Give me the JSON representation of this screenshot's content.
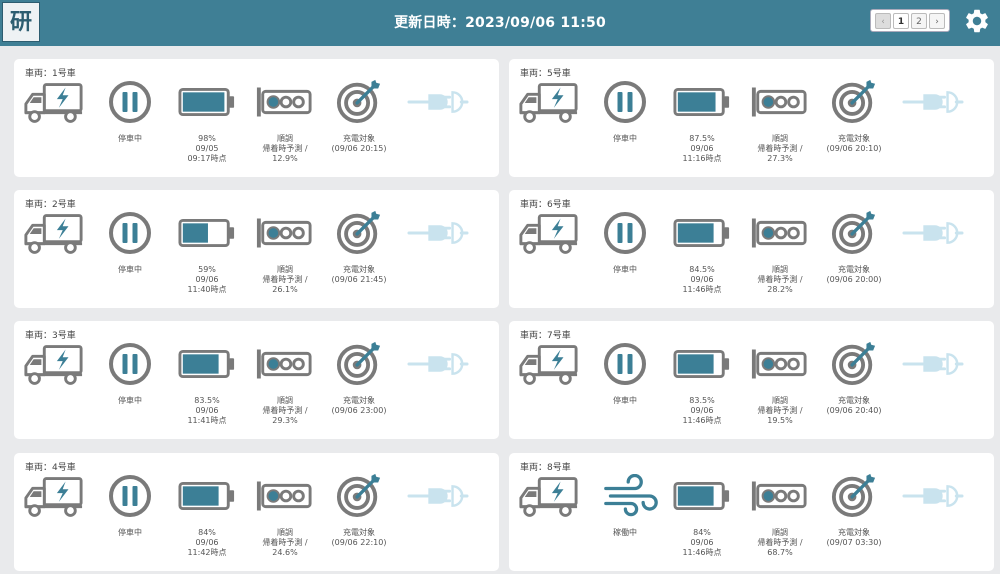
{
  "header": {
    "logo_text": "研",
    "title": "更新日時：2023/09/06 11:50",
    "pager": {
      "prev": "‹",
      "pages": [
        "1",
        "2"
      ],
      "next": "›",
      "current": "1"
    },
    "settings_icon": "gear-icon"
  },
  "colors": {
    "accent": "#3f7f95",
    "icon_gray": "#7a7a7a",
    "icon_teal": "#3c7f96",
    "plug_disabled": "#c9e3ee"
  },
  "vehicles": [
    {
      "name": "車両：1号車",
      "status_icon": "pause-icon",
      "status": "停車中",
      "battery_pct": "98%",
      "battery_date": "09/05",
      "battery_time": "09:17時点",
      "signal_label": "順調",
      "signal_sub": "帰着時予測 /",
      "signal_value": "12.9%",
      "target_label": "充電対象",
      "target_time": "(09/06 20:15)",
      "battery_level": 0.98
    },
    {
      "name": "車両：2号車",
      "status_icon": "pause-icon",
      "status": "停車中",
      "battery_pct": "59%",
      "battery_date": "09/06",
      "battery_time": "11:40時点",
      "signal_label": "順調",
      "signal_sub": "帰着時予測 /",
      "signal_value": "26.1%",
      "target_label": "充電対象",
      "target_time": "(09/06 21:45)",
      "battery_level": 0.59
    },
    {
      "name": "車両：3号車",
      "status_icon": "pause-icon",
      "status": "停車中",
      "battery_pct": "83.5%",
      "battery_date": "09/06",
      "battery_time": "11:41時点",
      "signal_label": "順調",
      "signal_sub": "帰着時予測 /",
      "signal_value": "29.3%",
      "target_label": "充電対象",
      "target_time": "(09/06 23:00)",
      "battery_level": 0.835
    },
    {
      "name": "車両：4号車",
      "status_icon": "pause-icon",
      "status": "停車中",
      "battery_pct": "84%",
      "battery_date": "09/06",
      "battery_time": "11:42時点",
      "signal_label": "順調",
      "signal_sub": "帰着時予測 /",
      "signal_value": "24.6%",
      "target_label": "充電対象",
      "target_time": "(09/06 22:10)",
      "battery_level": 0.84
    },
    {
      "name": "車両：5号車",
      "status_icon": "pause-icon",
      "status": "停車中",
      "battery_pct": "87.5%",
      "battery_date": "09/06",
      "battery_time": "11:16時点",
      "signal_label": "順調",
      "signal_sub": "帰着時予測 /",
      "signal_value": "27.3%",
      "target_label": "充電対象",
      "target_time": "(09/06 20:10)",
      "battery_level": 0.875
    },
    {
      "name": "車両：6号車",
      "status_icon": "pause-icon",
      "status": "停車中",
      "battery_pct": "84.5%",
      "battery_date": "09/06",
      "battery_time": "11:46時点",
      "signal_label": "順調",
      "signal_sub": "帰着時予測 /",
      "signal_value": "28.2%",
      "target_label": "充電対象",
      "target_time": "(09/06 20:00)",
      "battery_level": 0.845
    },
    {
      "name": "車両：7号車",
      "status_icon": "pause-icon",
      "status": "停車中",
      "battery_pct": "83.5%",
      "battery_date": "09/06",
      "battery_time": "11:46時点",
      "signal_label": "順調",
      "signal_sub": "帰着時予測 /",
      "signal_value": "19.5%",
      "target_label": "充電対象",
      "target_time": "(09/06 20:40)",
      "battery_level": 0.835
    },
    {
      "name": "車両：8号車",
      "status_icon": "wind-icon",
      "status": "稼働中",
      "battery_pct": "84%",
      "battery_date": "09/06",
      "battery_time": "11:46時点",
      "signal_label": "順調",
      "signal_sub": "帰着時予測 /",
      "signal_value": "68.7%",
      "target_label": "充電対象",
      "target_time": "(09/07 03:30)",
      "battery_level": 0.84
    }
  ]
}
